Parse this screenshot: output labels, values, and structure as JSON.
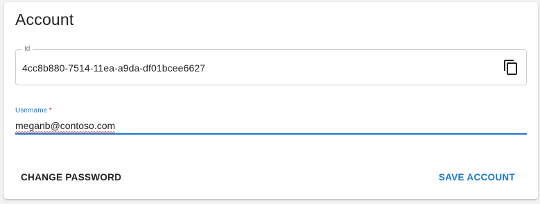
{
  "card": {
    "title": "Account"
  },
  "id_field": {
    "label": "Id",
    "value": "4cc8b880-7514-11ea-a9da-df01bcee6627",
    "action_icon": "copy-icon"
  },
  "username_field": {
    "label": "Username",
    "required_marker": "*",
    "value": "meganb@contoso.com"
  },
  "actions": {
    "change_password_label": "CHANGE PASSWORD",
    "save_account_label": "SAVE ACCOUNT"
  },
  "colors": {
    "accent": "#1976d2",
    "required": "#d32f2f",
    "text": "#212121"
  }
}
